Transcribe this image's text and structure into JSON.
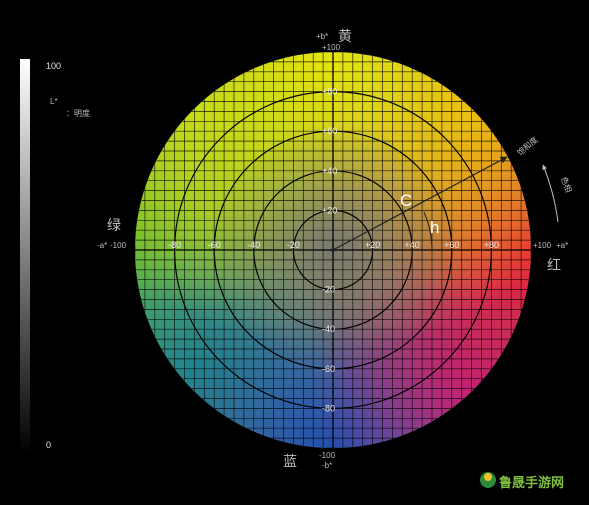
{
  "lightness_bar": {
    "top_value": "100",
    "bottom_value": "0",
    "symbol": "L*",
    "label": "：明度"
  },
  "axis_labels": {
    "top_value": "+100",
    "top_axis": "+b*",
    "top_color": "黄",
    "bottom_value": "-100",
    "bottom_axis": "-b*",
    "bottom_color": "蓝",
    "left_value": "-100",
    "left_axis": "-a*",
    "left_color": "绿",
    "right_value": "+100",
    "right_axis": "+a*",
    "right_color": "红"
  },
  "a_ticks": [
    "-80",
    "-60",
    "-40",
    "-20",
    "+20",
    "+40",
    "+60",
    "+80"
  ],
  "b_ticks": [
    "+80",
    "+60",
    "+40",
    "+20",
    "-20",
    "-40",
    "-60",
    "-80"
  ],
  "markers": {
    "chroma_symbol": "C",
    "hue_symbol": "h",
    "chroma_label": "饱和度",
    "hue_label": "色相"
  },
  "watermark": "鲁晟手游网",
  "colors": {
    "background": "#000000",
    "yellow": "#e5e70a",
    "red": "#e8183a",
    "green": "#5cb531",
    "blue": "#1f4fb0",
    "magenta": "#b3238f",
    "grid": "#000000"
  }
}
